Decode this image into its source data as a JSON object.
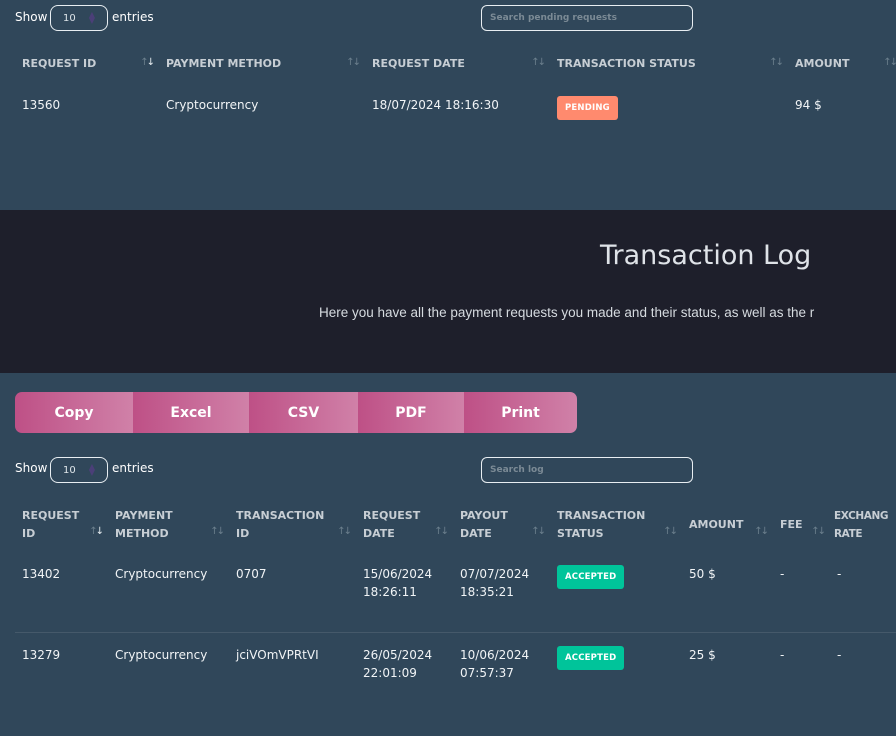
{
  "pending": {
    "show_label": "Show",
    "entries_label": "entries",
    "page_size": "10",
    "search_placeholder": "Search pending requests",
    "columns": [
      "REQUEST ID",
      "PAYMENT METHOD",
      "REQUEST DATE",
      "TRANSACTION STATUS",
      "AMOUNT"
    ],
    "rows": [
      {
        "request_id": "13560",
        "payment_method": "Cryptocurrency",
        "request_date": "18/07/2024 18:16:30",
        "status": "PENDING",
        "amount": "94 $"
      }
    ]
  },
  "log_header": {
    "title": "Transaction Log",
    "description": "Here you have all the payment requests you made and their status, as well as the r"
  },
  "log": {
    "export_buttons": [
      "Copy",
      "Excel",
      "CSV",
      "PDF",
      "Print"
    ],
    "show_label": "Show",
    "entries_label": "entries",
    "page_size": "10",
    "search_placeholder": "Search log",
    "columns": [
      {
        "l1": "REQUEST",
        "l2": "ID"
      },
      {
        "l1": "PAYMENT",
        "l2": "METHOD"
      },
      {
        "l1": "TRANSACTION",
        "l2": "ID"
      },
      {
        "l1": "REQUEST",
        "l2": "DATE"
      },
      {
        "l1": "PAYOUT",
        "l2": "DATE"
      },
      {
        "l1": "TRANSACTION",
        "l2": "STATUS"
      },
      {
        "l1": "AMOUNT",
        "l2": ""
      },
      {
        "l1": "FEE",
        "l2": ""
      },
      {
        "l1": "EXCHANG",
        "l2": "RATE"
      }
    ],
    "rows": [
      {
        "request_id": "13402",
        "payment_method": "Cryptocurrency",
        "transaction_id": "0707",
        "request_date": "15/06/2024",
        "request_time": "18:26:11",
        "payout_date": "07/07/2024",
        "payout_time": "18:35:21",
        "status": "ACCEPTED",
        "amount": "50 $",
        "fee": "-",
        "exchange_rate": "-"
      },
      {
        "request_id": "13279",
        "payment_method": "Cryptocurrency",
        "transaction_id": "jciVOmVPRtVI",
        "request_date": "26/05/2024",
        "request_time": "22:01:09",
        "payout_date": "10/06/2024",
        "payout_time": "07:57:37",
        "status": "ACCEPTED",
        "amount": "25 $",
        "fee": "-",
        "exchange_rate": "-"
      }
    ]
  },
  "colors": {
    "pending": "#ff8a6e",
    "accepted": "#00c49a",
    "export_button": "#c4588d",
    "band": "#1e1f2b",
    "panel": "#30475a"
  }
}
